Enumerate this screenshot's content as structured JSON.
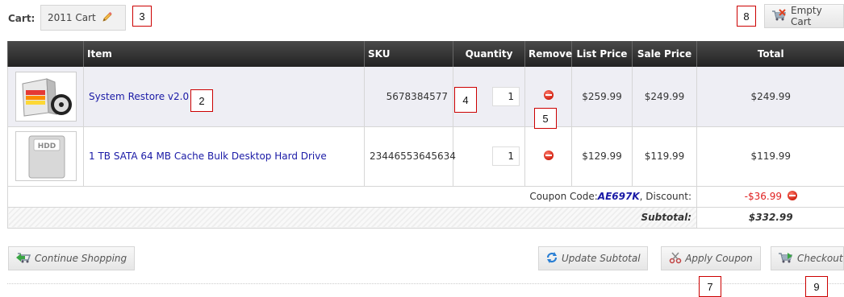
{
  "cart_bar": {
    "label": "Cart:",
    "cart_name": "2011 Cart",
    "empty_cart_label": "Empty Cart"
  },
  "table": {
    "headers": {
      "item": "Item",
      "sku": "SKU",
      "quantity": "Quantity",
      "remove": "Remove",
      "list_price": "List Price",
      "sale_price": "Sale Price",
      "total": "Total"
    },
    "rows": [
      {
        "thumb_icon": "software-box-icon",
        "name": "System Restore v2.0",
        "sku": "5678384577",
        "quantity": "1",
        "list_price": "$259.99",
        "sale_price": "$249.99",
        "total": "$249.99"
      },
      {
        "thumb_icon": "hdd-icon",
        "thumb_text": "HDD",
        "name": "1 TB SATA 64 MB Cache Bulk Desktop Hard Drive",
        "sku": "23446553645634",
        "quantity": "1",
        "list_price": "$129.99",
        "sale_price": "$119.99",
        "total": "$119.99"
      }
    ],
    "coupon": {
      "prefix": "Coupon Code:",
      "code": "AE697K",
      "suffix": ", Discount:",
      "amount": "-$36.99"
    },
    "subtotal": {
      "label": "Subtotal:",
      "amount": "$332.99"
    }
  },
  "buttons": {
    "continue_shopping": "Continue Shopping",
    "update_subtotal": "Update Subtotal",
    "apply_coupon": "Apply Coupon",
    "checkout": "Checkout"
  },
  "callouts": {
    "c2": "2",
    "c3": "3",
    "c4": "4",
    "c5": "5",
    "c7": "7",
    "c8": "8",
    "c9": "9"
  },
  "colors": {
    "header_bg": "#2b2b2b",
    "link": "#1a1aa6",
    "discount": "#e02020",
    "remove": "#d02010"
  }
}
